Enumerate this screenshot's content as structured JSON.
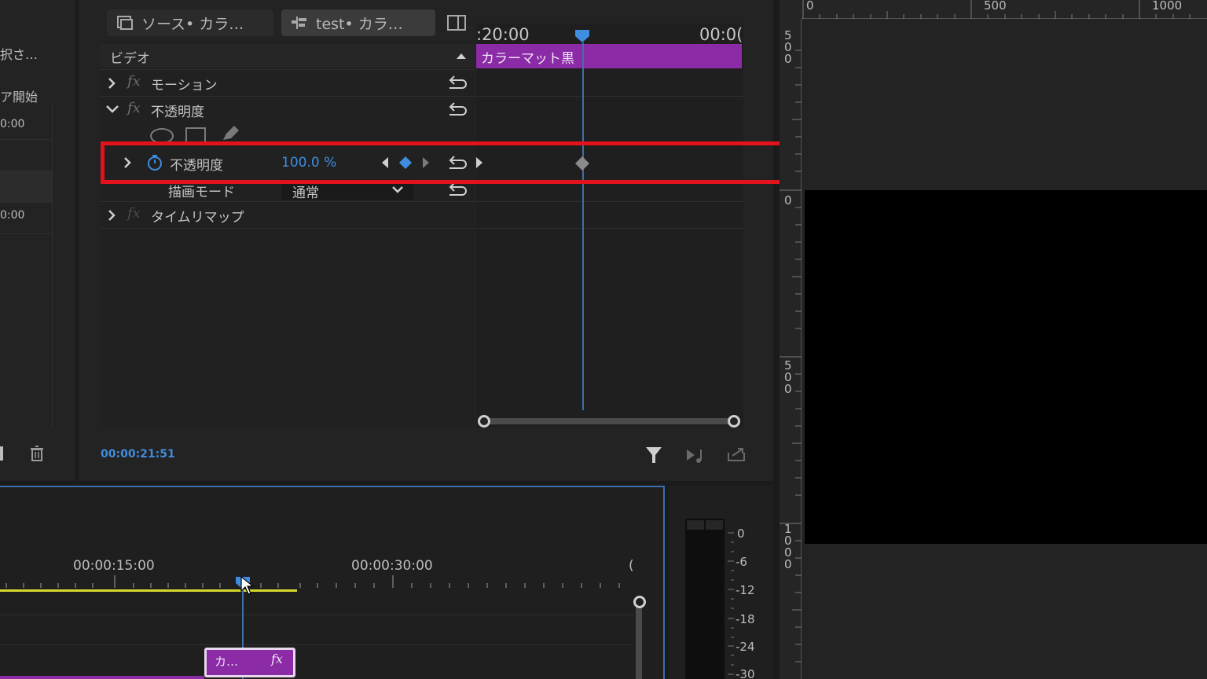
{
  "left_panel": {
    "texts": [
      "択さ…",
      "ア開始",
      "0:00",
      "0:00"
    ]
  },
  "effect_controls": {
    "tabs": [
      {
        "label": "ソース• カラ…",
        "icon": "source-clip-icon"
      },
      {
        "label": "test• カラ…",
        "icon": "sequence-icon"
      }
    ],
    "timecodes": [
      ":20:00",
      "00:0("
    ],
    "clip_name": "カラーマット黒",
    "section": "ビデオ",
    "effects": [
      {
        "label": "モーション"
      },
      {
        "label": "不透明度"
      },
      {
        "label": "タイムリマップ"
      }
    ],
    "opacity_param": {
      "label": "不透明度",
      "value": "100.0 %"
    },
    "blend_mode": {
      "label": "描画モード",
      "value": "通常"
    },
    "current_time": "00:00:21:51"
  },
  "monitor": {
    "ruler_h": [
      "0",
      "500",
      "1000"
    ],
    "ruler_v": [
      "500",
      "0",
      "500",
      "1000"
    ]
  },
  "timeline": {
    "times": [
      "00:00:15:00",
      "00:00:30:00",
      "("
    ],
    "clip": {
      "label": "カ…",
      "fx": "fx"
    }
  },
  "audio_meter": {
    "db_labels": [
      "0",
      "-6",
      "-12",
      "-18",
      "-24",
      "-30"
    ]
  },
  "colors": {
    "accent_blue": "#3f8de0",
    "clip_purple": "#8b2ba6",
    "highlight_red": "#e3121b",
    "work_area_yellow": "#d6d62c"
  }
}
